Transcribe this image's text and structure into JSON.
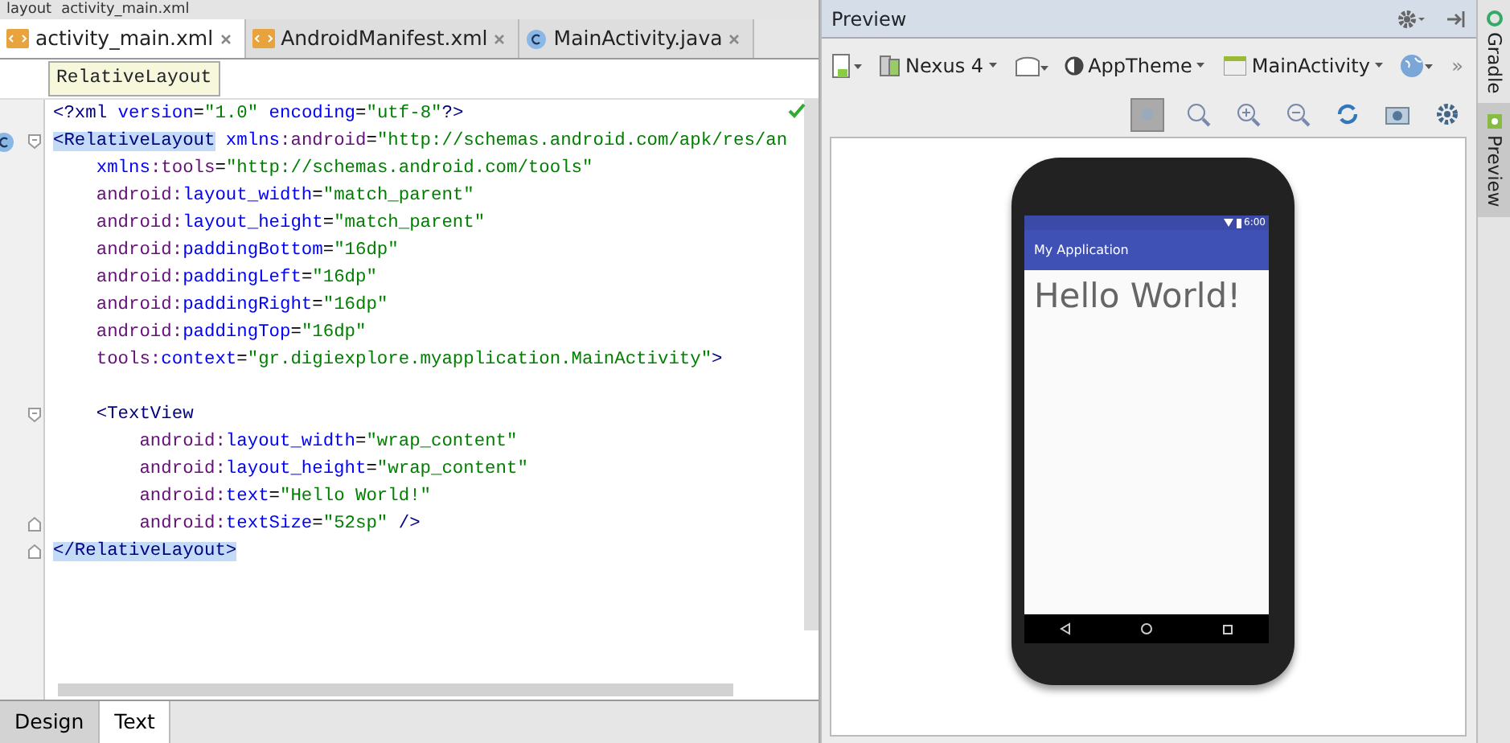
{
  "breadcrumb": [
    "layout",
    "activity_main.xml"
  ],
  "editor_tabs": [
    {
      "label": "activity_main.xml",
      "kind": "xml",
      "selected": true
    },
    {
      "label": "AndroidManifest.xml",
      "kind": "xml",
      "selected": false
    },
    {
      "label": "MainActivity.java",
      "kind": "class",
      "selected": false
    }
  ],
  "tag_tooltip": "RelativeLayout",
  "code_lines": [
    {
      "kind": "plain",
      "tokens": [
        {
          "kind": "tag",
          "text": "<?xml"
        },
        {
          "kind": "attr",
          "text": " version"
        },
        {
          "kind": "punct",
          "text": "="
        },
        {
          "kind": "value",
          "text": "\"1.0\""
        },
        {
          "kind": "attr",
          "text": " encoding"
        },
        {
          "kind": "punct",
          "text": "="
        },
        {
          "kind": "value",
          "text": "\"utf-8\""
        },
        {
          "kind": "tag",
          "text": "?>"
        }
      ]
    },
    {
      "kind": "fold-start",
      "tokens": [
        {
          "kind": "tag",
          "text": "<RelativeLayout",
          "highlighted": true
        },
        {
          "kind": "attr",
          "text": " xmlns"
        },
        {
          "kind": "ns",
          "text": ":android"
        },
        {
          "kind": "punct",
          "text": "="
        },
        {
          "kind": "value",
          "text": "\"http://schemas.android.com/apk/res/an"
        }
      ]
    },
    {
      "kind": "plain",
      "tokens": [
        {
          "kind": "attr",
          "text": "    xmlns"
        },
        {
          "kind": "ns",
          "text": ":tools"
        },
        {
          "kind": "punct",
          "text": "="
        },
        {
          "kind": "value",
          "text": "\"http://schemas.android.com/tools\""
        }
      ]
    },
    {
      "kind": "plain",
      "tokens": [
        {
          "kind": "ns",
          "text": "    android:"
        },
        {
          "kind": "attr",
          "text": "layout_width"
        },
        {
          "kind": "punct",
          "text": "="
        },
        {
          "kind": "value",
          "text": "\"match_parent\""
        }
      ]
    },
    {
      "kind": "plain",
      "tokens": [
        {
          "kind": "ns",
          "text": "    android:"
        },
        {
          "kind": "attr",
          "text": "layout_height"
        },
        {
          "kind": "punct",
          "text": "="
        },
        {
          "kind": "value",
          "text": "\"match_parent\""
        }
      ]
    },
    {
      "kind": "plain",
      "tokens": [
        {
          "kind": "ns",
          "text": "    android:"
        },
        {
          "kind": "attr",
          "text": "paddingBottom"
        },
        {
          "kind": "punct",
          "text": "="
        },
        {
          "kind": "value",
          "text": "\"16dp\""
        }
      ]
    },
    {
      "kind": "plain",
      "tokens": [
        {
          "kind": "ns",
          "text": "    android:"
        },
        {
          "kind": "attr",
          "text": "paddingLeft"
        },
        {
          "kind": "punct",
          "text": "="
        },
        {
          "kind": "value",
          "text": "\"16dp\""
        }
      ]
    },
    {
      "kind": "plain",
      "tokens": [
        {
          "kind": "ns",
          "text": "    android:"
        },
        {
          "kind": "attr",
          "text": "paddingRight"
        },
        {
          "kind": "punct",
          "text": "="
        },
        {
          "kind": "value",
          "text": "\"16dp\""
        }
      ]
    },
    {
      "kind": "plain",
      "tokens": [
        {
          "kind": "ns",
          "text": "    android:"
        },
        {
          "kind": "attr",
          "text": "paddingTop"
        },
        {
          "kind": "punct",
          "text": "="
        },
        {
          "kind": "value",
          "text": "\"16dp\""
        }
      ]
    },
    {
      "kind": "plain",
      "tokens": [
        {
          "kind": "ns",
          "text": "    tools:"
        },
        {
          "kind": "attr",
          "text": "context"
        },
        {
          "kind": "punct",
          "text": "="
        },
        {
          "kind": "value",
          "text": "\"gr.digiexplore.myapplication.MainActivity\""
        },
        {
          "kind": "tag",
          "text": ">"
        }
      ]
    },
    {
      "kind": "plain"
    },
    {
      "kind": "fold-start",
      "tokens": [
        {
          "kind": "tag",
          "text": "    <TextView"
        }
      ]
    },
    {
      "kind": "plain",
      "tokens": [
        {
          "kind": "ns",
          "text": "        android:"
        },
        {
          "kind": "attr",
          "text": "layout_width"
        },
        {
          "kind": "punct",
          "text": "="
        },
        {
          "kind": "value",
          "text": "\"wrap_content\""
        }
      ]
    },
    {
      "kind": "plain",
      "tokens": [
        {
          "kind": "ns",
          "text": "        android:"
        },
        {
          "kind": "attr",
          "text": "layout_height"
        },
        {
          "kind": "punct",
          "text": "="
        },
        {
          "kind": "value",
          "text": "\"wrap_content\""
        }
      ]
    },
    {
      "kind": "plain",
      "tokens": [
        {
          "kind": "ns",
          "text": "        android:"
        },
        {
          "kind": "attr",
          "text": "text"
        },
        {
          "kind": "punct",
          "text": "="
        },
        {
          "kind": "value",
          "text": "\"Hello World!\""
        }
      ]
    },
    {
      "kind": "fold-end",
      "tokens": [
        {
          "kind": "ns",
          "text": "        android:"
        },
        {
          "kind": "attr",
          "text": "textSize"
        },
        {
          "kind": "punct",
          "text": "="
        },
        {
          "kind": "value",
          "text": "\"52sp\""
        },
        {
          "kind": "tag",
          "text": " />"
        }
      ]
    },
    {
      "kind": "fold-end",
      "tokens": [
        {
          "kind": "tag",
          "text": "</RelativeLayout>",
          "highlighted": true
        }
      ]
    }
  ],
  "bottom_tabs": [
    {
      "label": "Design",
      "selected": false
    },
    {
      "label": "Text",
      "selected": true
    }
  ],
  "preview": {
    "title": "Preview",
    "toolbar": [
      {
        "kind": "device-icon"
      },
      {
        "kind": "device",
        "label": "Nexus 4"
      },
      {
        "kind": "orientation-icon"
      },
      {
        "kind": "theme",
        "label": "AppTheme"
      },
      {
        "kind": "activity",
        "label": "MainActivity"
      },
      {
        "kind": "globe-icon"
      }
    ],
    "overflow": "»",
    "zoom_tools": [
      {
        "kind": "pan",
        "selected": true
      },
      {
        "kind": "actual",
        "selected": false
      },
      {
        "kind": "zoom-in",
        "selected": false
      },
      {
        "kind": "zoom-out",
        "selected": false
      },
      {
        "kind": "refresh",
        "selected": false
      },
      {
        "kind": "camera",
        "selected": false
      },
      {
        "kind": "settings",
        "selected": false
      }
    ],
    "phone": {
      "status_time": "6:00",
      "app_title": "My Application",
      "content": "Hello World!"
    }
  },
  "side_tabs": [
    {
      "label": "Gradle",
      "selected": false
    },
    {
      "label": "Preview",
      "selected": true
    }
  ]
}
